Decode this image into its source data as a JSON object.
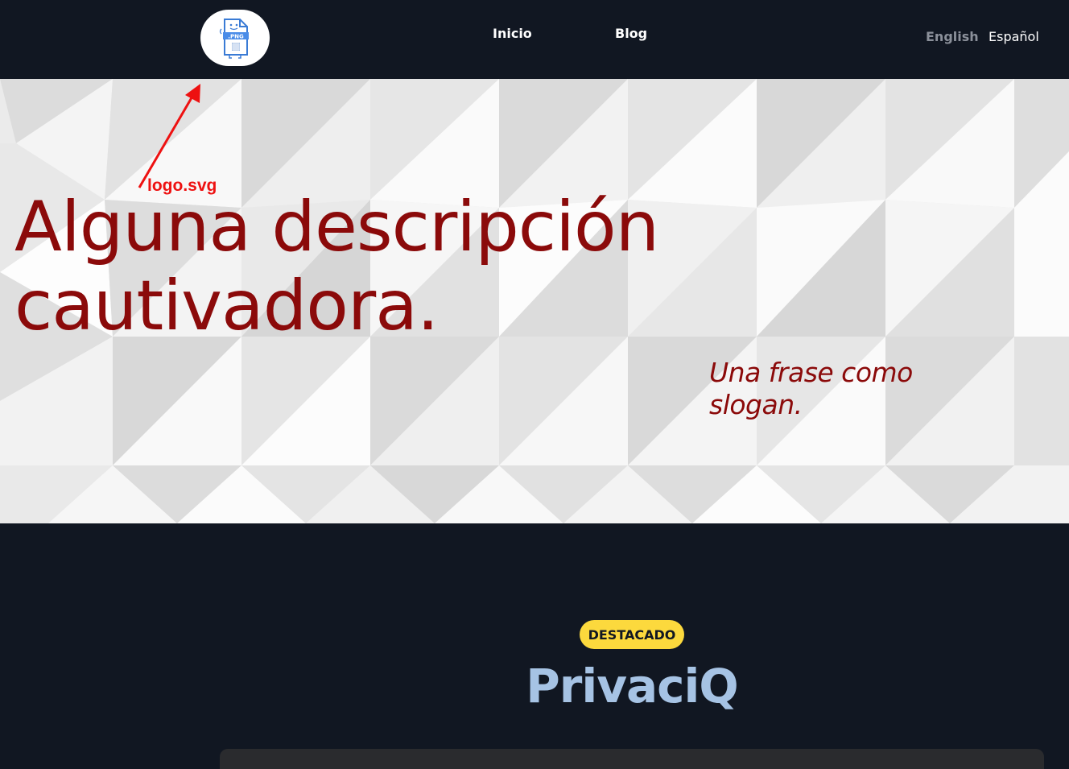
{
  "header": {
    "logo_alt": "PNG file logo",
    "nav": [
      {
        "label": "Inicio"
      },
      {
        "label": "Blog"
      }
    ],
    "languages": [
      {
        "label": "English",
        "active": false
      },
      {
        "label": "Español",
        "active": true
      }
    ]
  },
  "hero": {
    "title": "Alguna descripción cautivadora.",
    "slogan": "Una frase como slogan."
  },
  "annotation": {
    "label": "logo.svg"
  },
  "featured": {
    "badge": "DESTACADO",
    "title": "PrivaciQ"
  },
  "colors": {
    "header_bg": "#111722",
    "hero_text": "#8b0a0a",
    "badge_bg": "#fcd93d",
    "featured_title": "#a6c3e4",
    "annotation": "#ee1111"
  }
}
